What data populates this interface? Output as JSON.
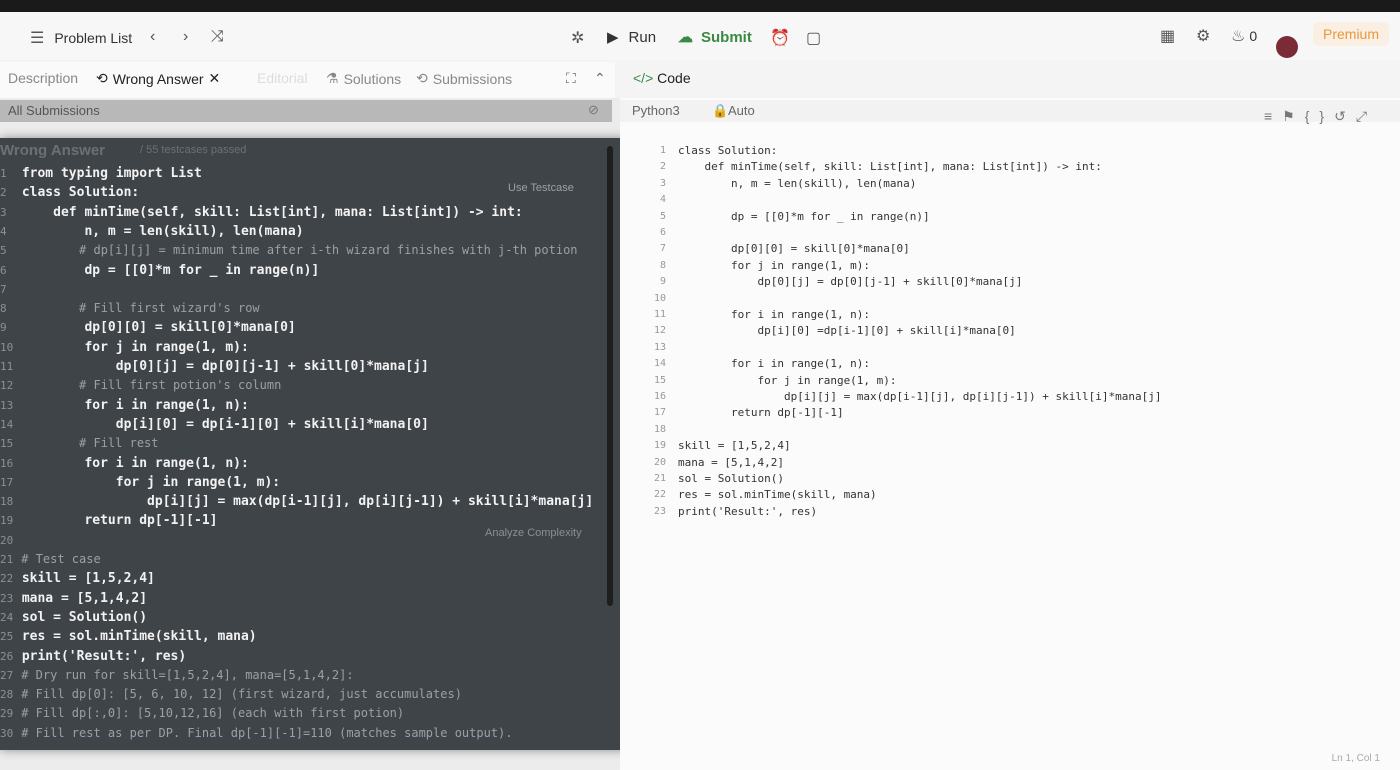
{
  "nav": {
    "problem_list": "Problem List",
    "run": "Run",
    "submit": "Submit",
    "streak_count": "0",
    "premium": "Premium"
  },
  "tabs": {
    "description": "Description",
    "wrong_answer": "Wrong Answer",
    "editorial": "Editorial",
    "solutions": "Solutions",
    "submissions": "Submissions",
    "code": "Code"
  },
  "left": {
    "all_submissions": "All Submissions",
    "wrong_answer_title": "Wrong Answer",
    "testcases_passed": "/ 55 testcases passed",
    "use_testcase": "Use Testcase",
    "analyze_complexity": "Analyze Complexity"
  },
  "overlay_code": [
    {
      "n": "1",
      "t": "from typing import List",
      "c": false
    },
    {
      "n": "2",
      "t": "class Solution:",
      "c": false
    },
    {
      "n": "3",
      "t": "    def minTime(self, skill: List[int], mana: List[int]) -> int:",
      "c": false
    },
    {
      "n": "4",
      "t": "        n, m = len(skill), len(mana)",
      "c": false
    },
    {
      "n": "5",
      "t": "        # dp[i][j] = minimum time after i-th wizard finishes with j-th potion",
      "c": true
    },
    {
      "n": "6",
      "t": "        dp = [[0]*m for _ in range(n)]",
      "c": false
    },
    {
      "n": "7",
      "t": "",
      "c": false
    },
    {
      "n": "8",
      "t": "        # Fill first wizard's row",
      "c": true
    },
    {
      "n": "9",
      "t": "        dp[0][0] = skill[0]*mana[0]",
      "c": false
    },
    {
      "n": "10",
      "t": "        for j in range(1, m):",
      "c": false
    },
    {
      "n": "11",
      "t": "            dp[0][j] = dp[0][j-1] + skill[0]*mana[j]",
      "c": false
    },
    {
      "n": "12",
      "t": "        # Fill first potion's column",
      "c": true
    },
    {
      "n": "13",
      "t": "        for i in range(1, n):",
      "c": false
    },
    {
      "n": "14",
      "t": "            dp[i][0] = dp[i-1][0] + skill[i]*mana[0]",
      "c": false
    },
    {
      "n": "15",
      "t": "        # Fill rest",
      "c": true
    },
    {
      "n": "16",
      "t": "        for i in range(1, n):",
      "c": false
    },
    {
      "n": "17",
      "t": "            for j in range(1, m):",
      "c": false
    },
    {
      "n": "18",
      "t": "                dp[i][j] = max(dp[i-1][j], dp[i][j-1]) + skill[i]*mana[j]",
      "c": false
    },
    {
      "n": "19",
      "t": "        return dp[-1][-1]",
      "c": false
    },
    {
      "n": "20",
      "t": "",
      "c": false
    },
    {
      "n": "21",
      "t": "# Test case",
      "c": true
    },
    {
      "n": "22",
      "t": "skill = [1,5,2,4]",
      "c": false
    },
    {
      "n": "23",
      "t": "mana = [5,1,4,2]",
      "c": false
    },
    {
      "n": "24",
      "t": "sol = Solution()",
      "c": false
    },
    {
      "n": "25",
      "t": "res = sol.minTime(skill, mana)",
      "c": false
    },
    {
      "n": "26",
      "t": "print('Result:', res)",
      "c": false
    },
    {
      "n": "27",
      "t": "# Dry run for skill=[1,5,2,4], mana=[5,1,4,2]:",
      "c": true
    },
    {
      "n": "28",
      "t": "# Fill dp[0]: [5, 6, 10, 12] (first wizard, just accumulates)",
      "c": true
    },
    {
      "n": "29",
      "t": "# Fill dp[:,0]: [5,10,12,16] (each with first potion)",
      "c": true
    },
    {
      "n": "30",
      "t": "# Fill rest as per DP. Final dp[-1][-1]=110 (matches sample output).",
      "c": true
    }
  ],
  "editor": {
    "language": "Python3",
    "mode": "Auto",
    "status": "Ln 1, Col 1",
    "lines": [
      {
        "n": "1",
        "t": "class Solution:"
      },
      {
        "n": "2",
        "t": "    def minTime(self, skill: List[int], mana: List[int]) -> int:"
      },
      {
        "n": "3",
        "t": "        n, m = len(skill), len(mana)"
      },
      {
        "n": "4",
        "t": ""
      },
      {
        "n": "5",
        "t": "        dp = [[0]*m for _ in range(n)]"
      },
      {
        "n": "6",
        "t": ""
      },
      {
        "n": "7",
        "t": "        dp[0][0] = skill[0]*mana[0]"
      },
      {
        "n": "8",
        "t": "        for j in range(1, m):"
      },
      {
        "n": "9",
        "t": "            dp[0][j] = dp[0][j-1] + skill[0]*mana[j]"
      },
      {
        "n": "10",
        "t": ""
      },
      {
        "n": "11",
        "t": "        for i in range(1, n):"
      },
      {
        "n": "12",
        "t": "            dp[i][0] =dp[i-1][0] + skill[i]*mana[0]"
      },
      {
        "n": "13",
        "t": ""
      },
      {
        "n": "14",
        "t": "        for i in range(1, n):"
      },
      {
        "n": "15",
        "t": "            for j in range(1, m):"
      },
      {
        "n": "16",
        "t": "                dp[i][j] = max(dp[i-1][j], dp[i][j-1]) + skill[i]*mana[j]"
      },
      {
        "n": "17",
        "t": "        return dp[-1][-1]"
      },
      {
        "n": "18",
        "t": ""
      },
      {
        "n": "19",
        "t": "skill = [1,5,2,4]"
      },
      {
        "n": "20",
        "t": "mana = [5,1,4,2]"
      },
      {
        "n": "21",
        "t": "sol = Solution()"
      },
      {
        "n": "22",
        "t": "res = sol.minTime(skill, mana)"
      },
      {
        "n": "23",
        "t": "print('Result:', res)"
      }
    ]
  }
}
